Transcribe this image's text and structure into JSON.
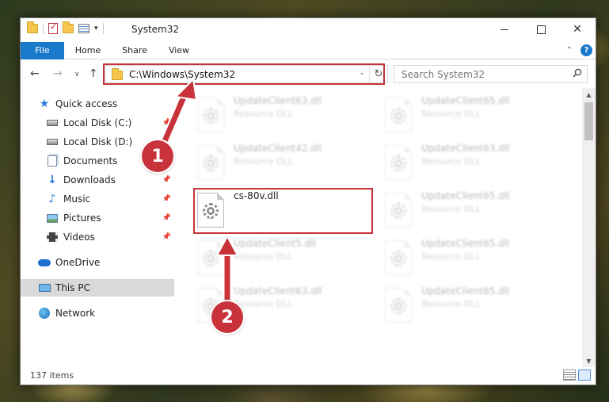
{
  "window": {
    "title": "System32",
    "controls": {
      "minimize": "",
      "maximize": "",
      "close": "✕"
    }
  },
  "ribbon": {
    "tabs": [
      "File",
      "Home",
      "Share",
      "View"
    ],
    "file_tab_color": "#1979ca",
    "collapse_icon": "chevron-up-icon",
    "help_label": "?"
  },
  "address": {
    "path": "C:\\Windows\\System32",
    "dropdown": "⌄",
    "refresh": "↻",
    "search_placeholder": "Search System32"
  },
  "navigation": {
    "back": "←",
    "forward": "→",
    "recent": "∨",
    "up": "↑"
  },
  "sidebar": {
    "items": [
      {
        "label": "Quick access",
        "icon": "star-icon"
      },
      {
        "label": "Local Disk (C:)",
        "icon": "drive-icon",
        "pinned": true
      },
      {
        "label": "Local Disk (D:)",
        "icon": "drive-icon",
        "pinned": true
      },
      {
        "label": "Documents",
        "icon": "documents-icon",
        "pinned": true
      },
      {
        "label": "Downloads",
        "icon": "download-icon",
        "pinned": true
      },
      {
        "label": "Music",
        "icon": "music-icon",
        "pinned": true
      },
      {
        "label": "Pictures",
        "icon": "pictures-icon",
        "pinned": true
      },
      {
        "label": "Videos",
        "icon": "videos-icon",
        "pinned": true
      },
      {
        "label": "OneDrive",
        "icon": "cloud-icon"
      },
      {
        "label": "This PC",
        "icon": "computer-icon",
        "selected": true
      },
      {
        "label": "Network",
        "icon": "network-icon"
      }
    ],
    "pin_glyph": "📌"
  },
  "files": [
    {
      "name": "UpdateClient63.dll",
      "type": "Resource DLL",
      "faded": true
    },
    {
      "name": "UpdateClient65.dll",
      "type": "Resource DLL",
      "faded": true
    },
    {
      "name": "UpdateClient42.dll",
      "type": "Resource DLL",
      "faded": true
    },
    {
      "name": "UpdateClient63.dll",
      "type": "Resource DLL",
      "faded": true
    },
    {
      "name": "cs-80v.dll",
      "type": "",
      "faded": false
    },
    {
      "name": "UpdateClient65.dll",
      "type": "Resource DLL",
      "faded": true
    },
    {
      "name": "UpdateClient5.dll",
      "type": "Resource DLL",
      "faded": true
    },
    {
      "name": "UpdateClient65.dll",
      "type": "Resource DLL",
      "faded": true
    },
    {
      "name": "UpdateClient63.dll",
      "type": "Resource DLL",
      "faded": true
    },
    {
      "name": "UpdateClient65.dll",
      "type": "Resource DLL",
      "faded": true
    }
  ],
  "status": {
    "item_count": "137 items"
  },
  "annotations": {
    "color": "#c8323a",
    "step1": "1",
    "step2": "2"
  }
}
